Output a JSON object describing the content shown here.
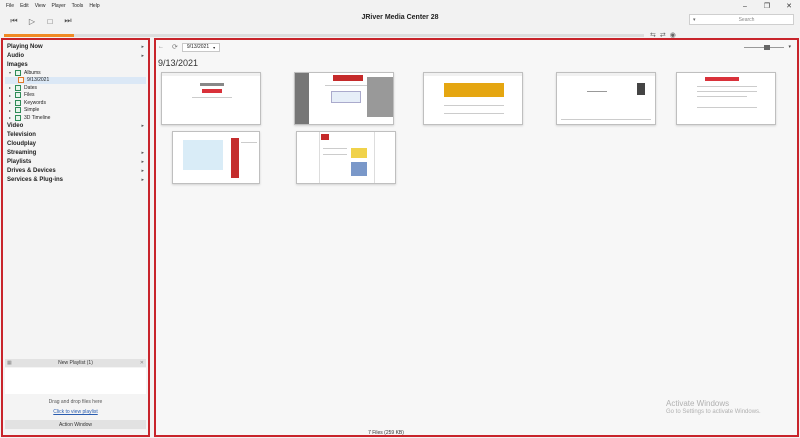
{
  "window": {
    "title": "JRiver Media Center 28"
  },
  "menu": [
    "File",
    "Edit",
    "View",
    "Player",
    "Tools",
    "Help"
  ],
  "window_controls": {
    "minimize": "–",
    "restore": "❐",
    "close": "✕"
  },
  "transport": {
    "prev": "⏮",
    "play": "▷",
    "stop": "□",
    "next": "⏭"
  },
  "search": {
    "placeholder": "Search",
    "dropdown": "▾"
  },
  "playback_progress": 0.11,
  "progress_icons": [
    "⇆",
    "⇄",
    "◉"
  ],
  "sidebar": {
    "categories_top": [
      {
        "label": "Playing Now",
        "arrow": "▸"
      },
      {
        "label": "Audio",
        "arrow": "▸"
      },
      {
        "label": "Images",
        "arrow": ""
      }
    ],
    "images_children": [
      {
        "label": "Albums",
        "toggle": "▾"
      },
      {
        "label": "9/13/2021",
        "toggle": ""
      },
      {
        "label": "Dates",
        "toggle": "▸"
      },
      {
        "label": "Files",
        "toggle": "▸"
      },
      {
        "label": "Keywords",
        "toggle": "▸"
      },
      {
        "label": "Simple",
        "toggle": "▸"
      },
      {
        "label": "3D Timeline",
        "toggle": "▸"
      }
    ],
    "categories_bottom": [
      {
        "label": "Video",
        "arrow": "▸"
      },
      {
        "label": "Television",
        "arrow": ""
      },
      {
        "label": "Cloudplay",
        "arrow": ""
      },
      {
        "label": "Streaming",
        "arrow": "▸"
      },
      {
        "label": "Playlists",
        "arrow": "▸"
      },
      {
        "label": "Drives & Devices",
        "arrow": "▸"
      },
      {
        "label": "Services & Plug-ins",
        "arrow": "▸"
      }
    ],
    "playlist": {
      "title": "New Playlist (1)",
      "drop_hint": "Drag and drop files here",
      "view_link": "Click to view playlist"
    },
    "action_window": "Action Window"
  },
  "content": {
    "nav_back": "←",
    "refresh": "⟳",
    "date_tab": "9/13/2021",
    "date_tab_caret": "▾",
    "heading": "9/13/2021",
    "zoom_dropdown": "▾",
    "status": "7 Files (259 KB)"
  },
  "watermark": {
    "line1": "Activate Windows",
    "line2": "Go to Settings to activate Windows."
  },
  "colors": {
    "highlight_border": "#c8242b",
    "progress": "#f08a24",
    "selected_row": "#dbe8f6"
  }
}
